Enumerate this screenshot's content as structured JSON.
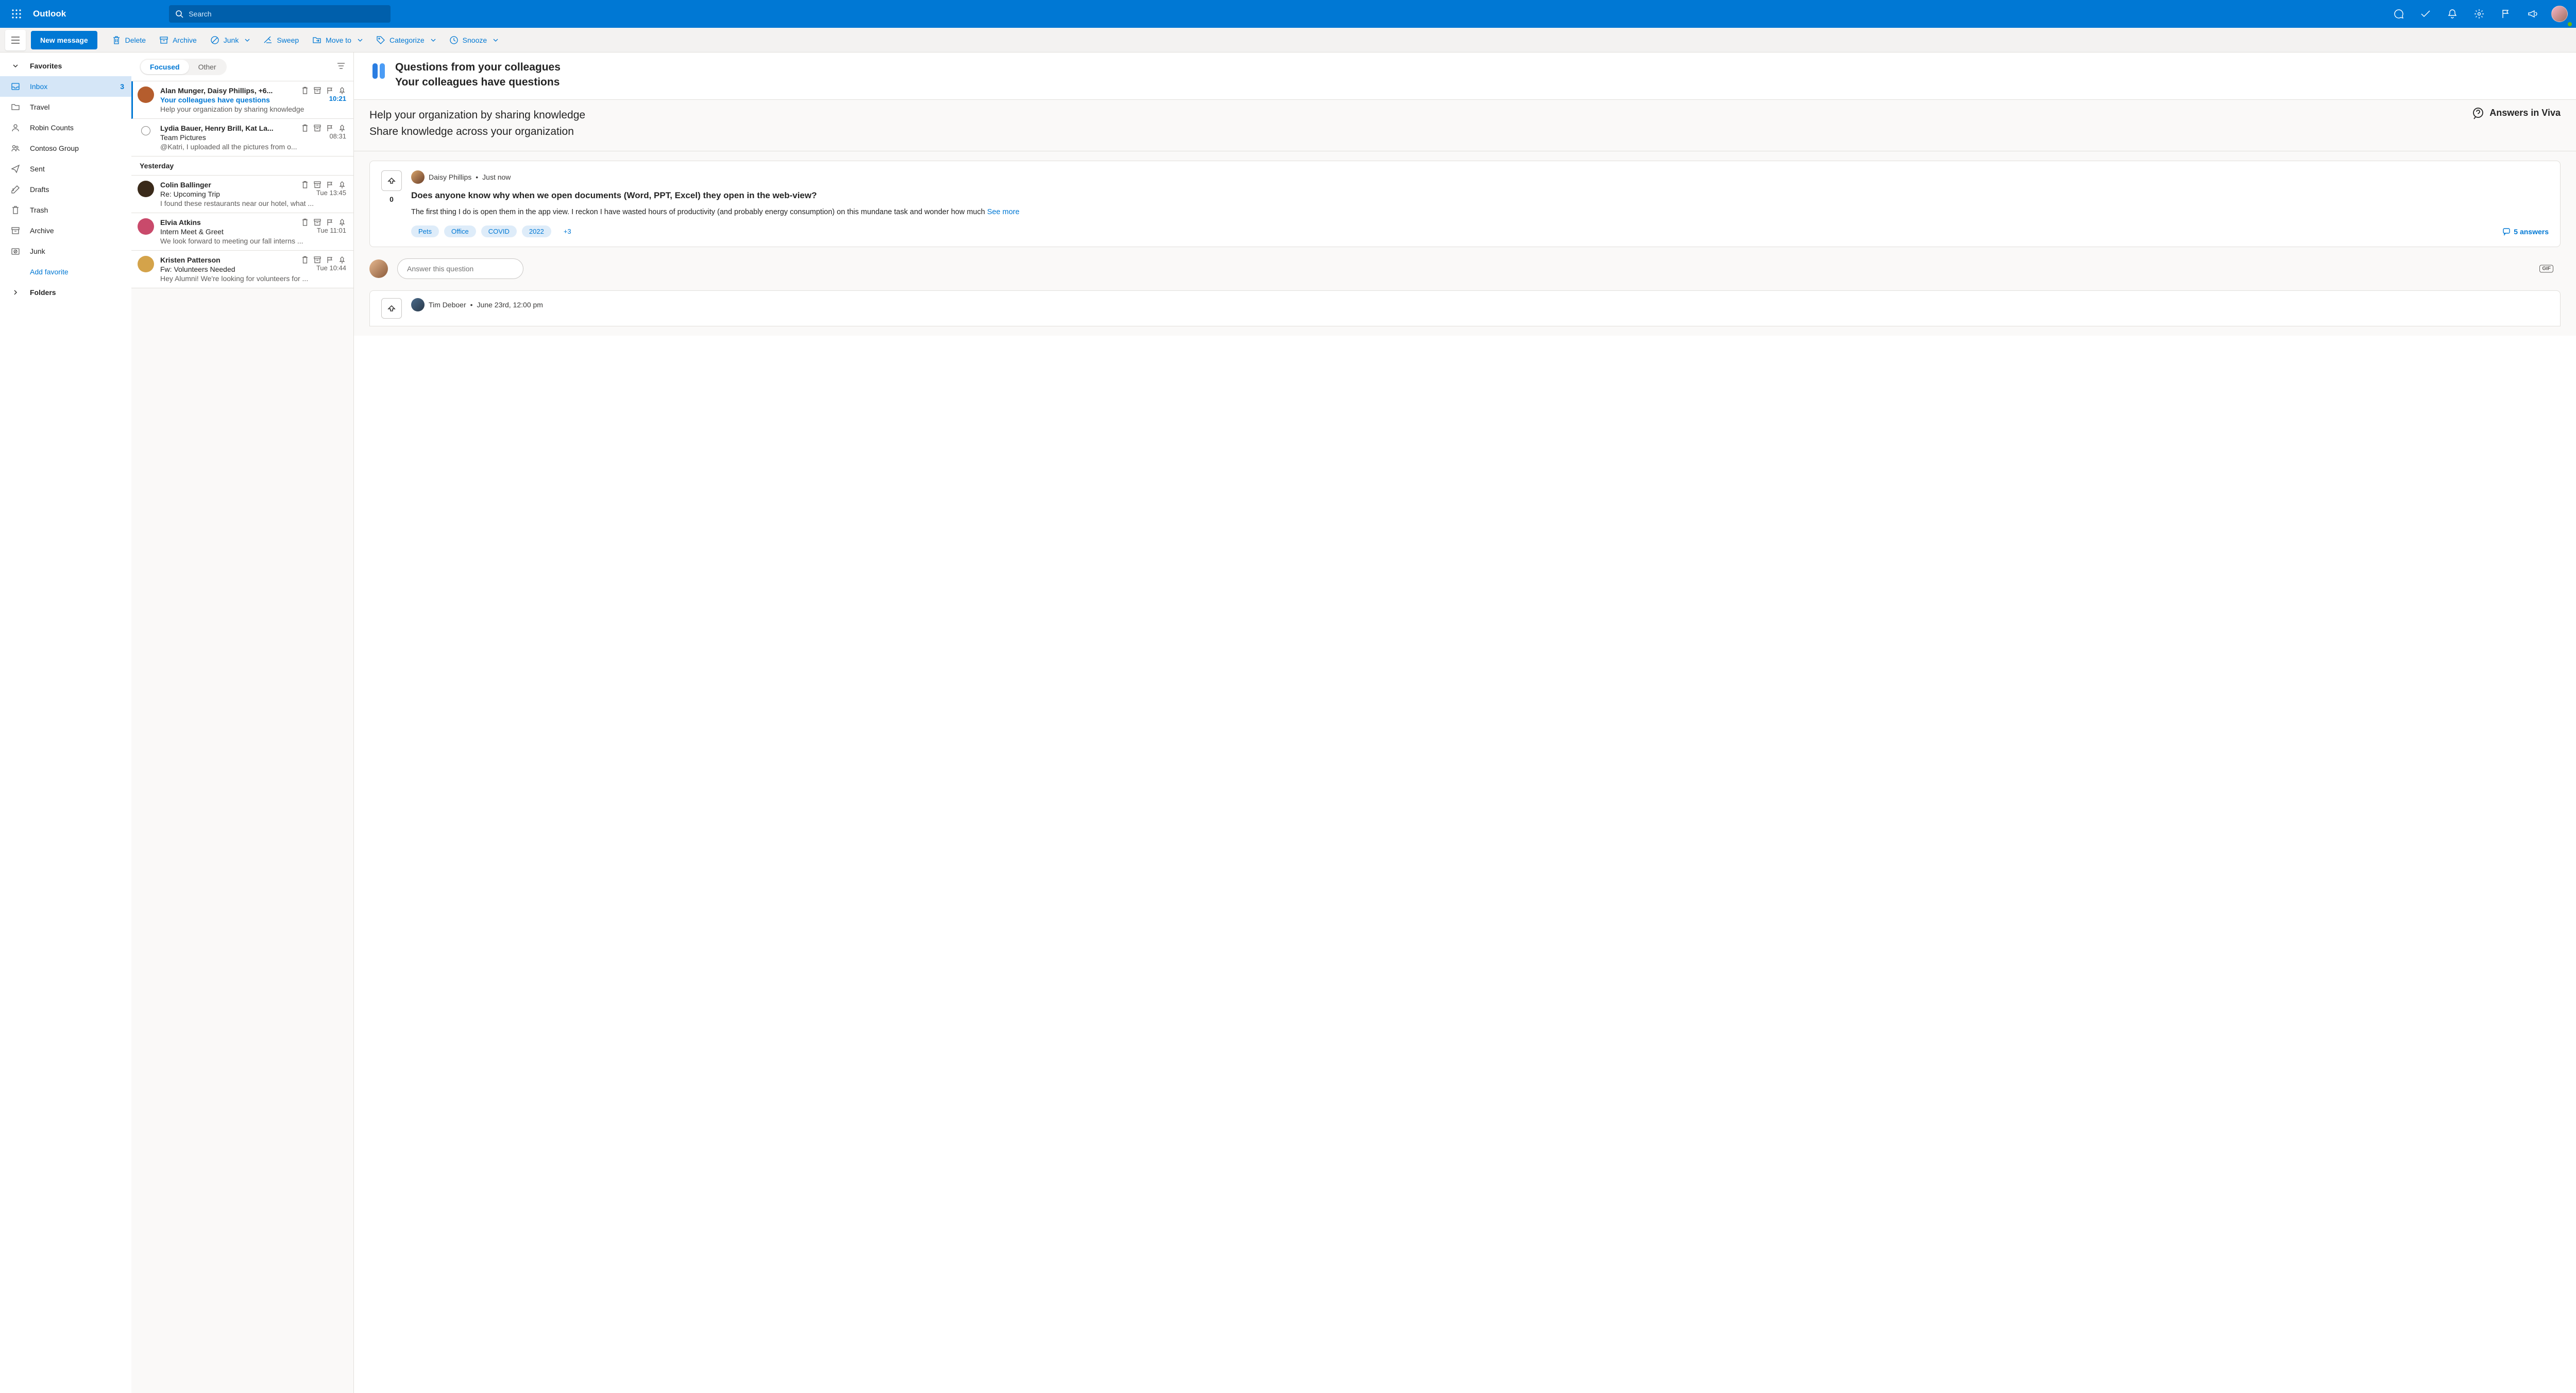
{
  "app": {
    "name": "Outlook",
    "search_placeholder": "Search"
  },
  "toolbar": {
    "new_message": "New message",
    "delete": "Delete",
    "archive": "Archive",
    "junk": "Junk",
    "sweep": "Sweep",
    "move_to": "Move to",
    "categorize": "Categorize",
    "snooze": "Snooze"
  },
  "nav": {
    "favorites": "Favorites",
    "items": [
      {
        "label": "Inbox",
        "badge": "3"
      },
      {
        "label": "Travel"
      },
      {
        "label": "Robin Counts"
      },
      {
        "label": "Contoso Group"
      },
      {
        "label": "Sent"
      },
      {
        "label": "Drafts"
      },
      {
        "label": "Trash"
      },
      {
        "label": "Archive"
      },
      {
        "label": "Junk"
      }
    ],
    "add": "Add favorite",
    "folders": "Folders"
  },
  "tabs": {
    "focused": "Focused",
    "other": "Other"
  },
  "messages": [
    {
      "from": "Alan Munger, Daisy Phillips, +6...",
      "subject": "Your colleagues have questions",
      "time": "10:21",
      "preview": "Help your organization by sharing knowledge",
      "avatar": "#b55d2d"
    },
    {
      "from": "Lydia Bauer, Henry Brill, Kat La...",
      "subject": "Team Pictures",
      "time": "08:31",
      "preview": "@Katri, I uploaded all the pictures from o..."
    }
  ],
  "yesterday": "Yesterday",
  "messages_y": [
    {
      "from": "Colin Ballinger",
      "subject": "Re: Upcoming Trip",
      "time": "Tue 13:45",
      "preview": "I found these restaurants near our hotel, what ...",
      "avatar": "#3a2a1a"
    },
    {
      "from": "Elvia Atkins",
      "subject": "Intern Meet & Greet",
      "time": "Tue 11:01",
      "preview": "We look forward to meeting our fall interns ...",
      "avatar": "#c94a6b"
    },
    {
      "from": "Kristen Patterson",
      "subject": "Fw: Volunteers Needed",
      "time": "Tue 10:44",
      "preview": "Hey Alumni! We're looking for volunteers for ...",
      "avatar": "#d4a34a"
    }
  ],
  "reading": {
    "title1": "Questions from your colleagues",
    "title2": "Your colleagues have questions",
    "line1": "Help your organization by sharing knowledge",
    "line2": "Share knowledge across your organization",
    "viva": "Answers in Viva"
  },
  "card": {
    "author": "Daisy Phillips",
    "sep": "•",
    "time": "Just now",
    "vote_count": "0",
    "question": "Does anyone know why when we open documents (Word, PPT, Excel) they open in the web-view?",
    "body": "The first thing I do is open them in the app view. I reckon I have wasted hours of productivity (and probably energy consumption) on this mundane task and wonder how much ",
    "see_more": "See more",
    "tags": [
      "Pets",
      "Office",
      "COVID",
      "2022",
      "+3"
    ],
    "answers": "5 answers",
    "reply_placeholder": "Answer this question",
    "gif": "GIF"
  },
  "card2": {
    "author": "Tim Deboer",
    "sep": "•",
    "time": "June 23rd, 12:00 pm"
  }
}
